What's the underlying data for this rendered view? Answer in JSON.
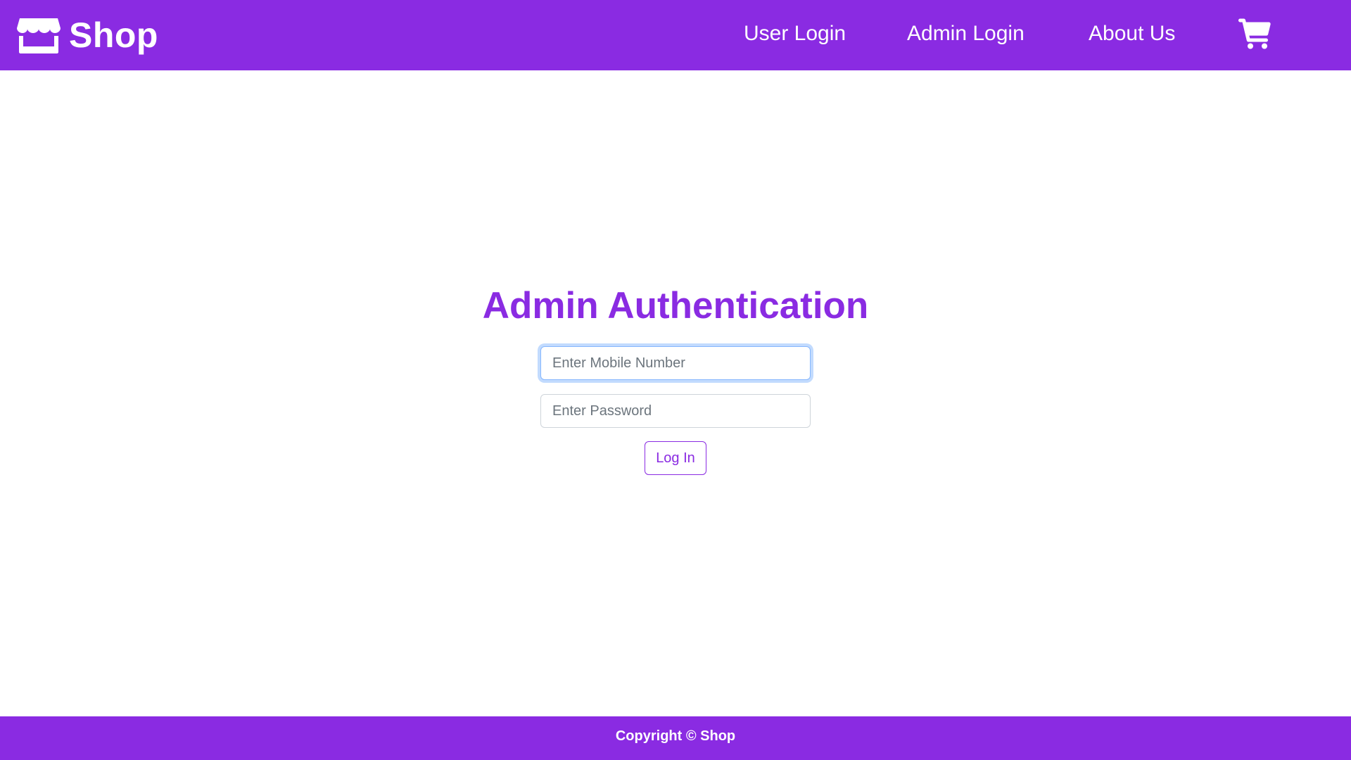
{
  "header": {
    "brand": {
      "icon": "store-icon",
      "label": "Shop"
    },
    "nav": {
      "user_login": "User Login",
      "admin_login": "Admin Login",
      "about_us": "About Us"
    },
    "cart_icon": "shopping-cart-icon"
  },
  "main": {
    "title": "Admin Authentication",
    "mobile_field": {
      "placeholder": "Enter Mobile Number",
      "value": ""
    },
    "password_field": {
      "placeholder": "Enter Password",
      "value": ""
    },
    "login_button": "Log In"
  },
  "footer": {
    "text": "Copyright © Shop"
  },
  "colors": {
    "accent": "#8a2be2",
    "background": "#ffffff",
    "focus_ring": "#86b7fe"
  }
}
